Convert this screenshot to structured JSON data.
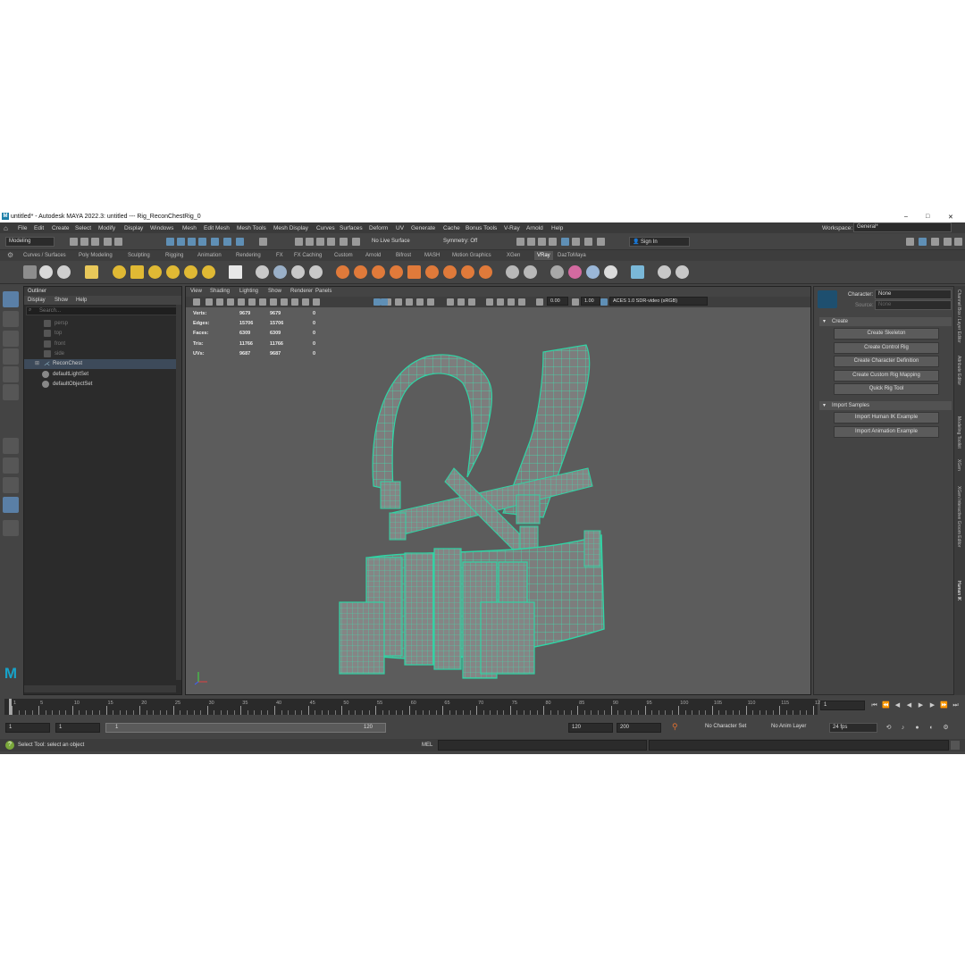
{
  "title_bar": {
    "title": "untitled* - Autodesk MAYA 2022.3: untitled   ---   Rig_ReconChestRig_0",
    "minimize": "–",
    "maximize": "□",
    "close": "✕"
  },
  "menu": {
    "items": [
      "File",
      "Edit",
      "Create",
      "Select",
      "Modify",
      "Display",
      "Windows",
      "Mesh",
      "Edit Mesh",
      "Mesh Tools",
      "Mesh Display",
      "Curves",
      "Surfaces",
      "Deform",
      "UV",
      "Generate",
      "Cache",
      "Bonus Tools",
      "V-Ray",
      "Arnold",
      "Help"
    ],
    "workspace_label": "Workspace:",
    "workspace_value": "General*"
  },
  "status_line": {
    "mode": "Modeling",
    "live_surface": "No Live Surface",
    "symmetry": "Symmetry: Off",
    "sign_in": "Sign In"
  },
  "shelf": {
    "tabs": [
      "Curves / Surfaces",
      "Poly Modeling",
      "Sculpting",
      "Rigging",
      "Animation",
      "Rendering",
      "FX",
      "FX Caching",
      "Custom",
      "Arnold",
      "Bifrost",
      "MASH",
      "Motion Graphics",
      "XGen",
      "VRay",
      "DazToMaya"
    ],
    "active_tab": "VRay"
  },
  "outliner": {
    "title": "Outliner",
    "menus": [
      "Display",
      "Show",
      "Help"
    ],
    "search_placeholder": "Search...",
    "items": [
      {
        "label": "persp",
        "dim": true
      },
      {
        "label": "top",
        "dim": true
      },
      {
        "label": "front",
        "dim": true
      },
      {
        "label": "side",
        "dim": true
      },
      {
        "label": "ReconChest",
        "dim": false,
        "selected": true
      },
      {
        "label": "defaultLightSet",
        "dim": false
      },
      {
        "label": "defaultObjectSet",
        "dim": false
      }
    ]
  },
  "viewport": {
    "menus": [
      "View",
      "Shading",
      "Lighting",
      "Show",
      "Renderer",
      "Panels"
    ],
    "field_a": "0.00",
    "field_b": "1.00",
    "color_space": "ACES 1.0 SDR-video (sRGB)",
    "hud": {
      "rows": [
        {
          "label": "Verts:",
          "v1": "9679",
          "v2": "9679",
          "v3": "0"
        },
        {
          "label": "Edges:",
          "v1": "15706",
          "v2": "15706",
          "v3": "0"
        },
        {
          "label": "Faces:",
          "v1": "6309",
          "v2": "6309",
          "v3": "0"
        },
        {
          "label": "Tris:",
          "v1": "11766",
          "v2": "11766",
          "v3": "0"
        },
        {
          "label": "UVs:",
          "v1": "9687",
          "v2": "9687",
          "v3": "0"
        }
      ]
    }
  },
  "human_ik": {
    "character_label": "Character:",
    "character_value": "None",
    "source_label": "Source:",
    "source_value": "None",
    "create_header": "Create",
    "create_buttons": [
      "Create Skeleton",
      "Create Control Rig",
      "Create Character Definition",
      "Create Custom Rig Mapping",
      "Quick Rig Tool"
    ],
    "import_header": "Import Samples",
    "import_buttons": [
      "Import Human IK Example",
      "Import Animation Example"
    ]
  },
  "side_tabs": [
    "Channel Box / Layer Editor",
    "Attribute Editor",
    "Modeling Toolkit",
    "XGen",
    "XGen Interactive Groom Editor",
    "Human IK"
  ],
  "time_slider": {
    "labels": [
      "1",
      "5",
      "10",
      "15",
      "20",
      "25",
      "30",
      "35",
      "40",
      "45",
      "50",
      "55",
      "60",
      "65",
      "70",
      "75",
      "80",
      "85",
      "90",
      "95",
      "100",
      "105",
      "110",
      "115",
      "120"
    ],
    "current_frame": "1"
  },
  "range_slider": {
    "start": "1",
    "start_inner": "1",
    "range_start": "1",
    "range_end": "120",
    "end_inner": "120",
    "end": "200",
    "character_set": "No Character Set",
    "anim_layer": "No Anim Layer",
    "fps": "24 fps"
  },
  "command_line": {
    "help_text": "Select Tool: select an object",
    "lang": "MEL"
  }
}
